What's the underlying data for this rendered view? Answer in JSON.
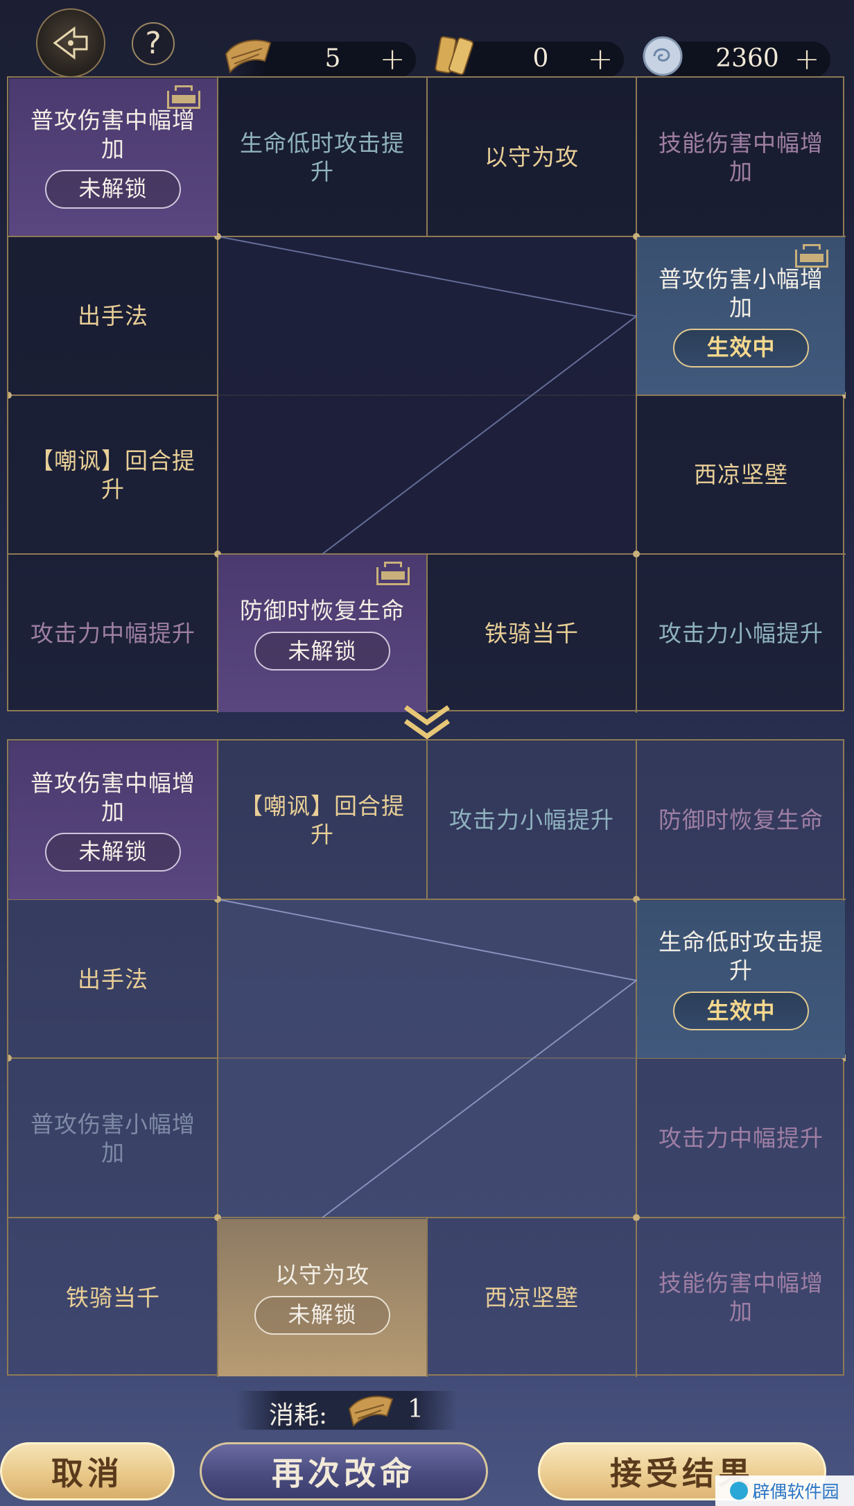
{
  "resources": [
    {
      "name": "scroll",
      "value": "5",
      "plus": "+"
    },
    {
      "name": "token",
      "value": "0",
      "plus": "+"
    },
    {
      "name": "jade",
      "value": "2360",
      "plus": "+"
    }
  ],
  "help_label": "?",
  "current_board": {
    "cells": [
      {
        "text": "普攻伤害中幅增加",
        "badge": "未解锁",
        "style": "purple",
        "lock": true
      },
      {
        "text": "生命低时攻击提升",
        "style": "teal"
      },
      {
        "text": "以守为攻",
        "style": "gold"
      },
      {
        "text": "技能伤害中幅增加",
        "style": "pinkdim"
      },
      {
        "text": "出手法",
        "style": "gold"
      },
      {
        "text": "普攻伤害小幅增加",
        "badge": "生效中",
        "style": "bluehl",
        "lock": true
      },
      {
        "text": "【嘲讽】回合提升",
        "style": "gold"
      },
      {
        "text": "西凉坚壁",
        "style": "gold"
      },
      {
        "text": "攻击力中幅提升",
        "style": "pinkdim"
      },
      {
        "text": "防御时恢复生命",
        "badge": "未解锁",
        "style": "purple",
        "lock": true
      },
      {
        "text": "铁骑当千",
        "style": "gold"
      },
      {
        "text": "攻击力小幅提升",
        "style": "teal"
      }
    ]
  },
  "result_board": {
    "cells": [
      {
        "text": "普攻伤害中幅增加",
        "badge": "未解锁",
        "style": "purple"
      },
      {
        "text": "【嘲讽】回合提升",
        "style": "gold"
      },
      {
        "text": "攻击力小幅提升",
        "style": "teal"
      },
      {
        "text": "防御时恢复生命",
        "style": "pinkdim"
      },
      {
        "text": "出手法",
        "style": "gold"
      },
      {
        "text": "生命低时攻击提升",
        "badge": "生效中",
        "style": "bluehl"
      },
      {
        "text": "普攻伤害小幅增加",
        "style": "grayblue"
      },
      {
        "text": "攻击力中幅提升",
        "style": "pinkdim"
      },
      {
        "text": "铁骑当千",
        "style": "gold"
      },
      {
        "text": "以守为攻",
        "badge": "未解锁",
        "style": "goldhl"
      },
      {
        "text": "西凉坚壁",
        "style": "gold"
      },
      {
        "text": "技能伤害中幅增加",
        "style": "pinkdim"
      }
    ]
  },
  "cost": {
    "label": "消耗:",
    "amount": "1"
  },
  "buttons": {
    "cancel": "取消",
    "retry": "再次改命",
    "accept": "接受结果"
  },
  "watermark": "辟偶软件园",
  "colors": {
    "gold_text": "#e9cf97",
    "teal_text": "#8fb2bf",
    "purple_cell": "#4a3a6e",
    "active_badge": "#f6d98e"
  }
}
